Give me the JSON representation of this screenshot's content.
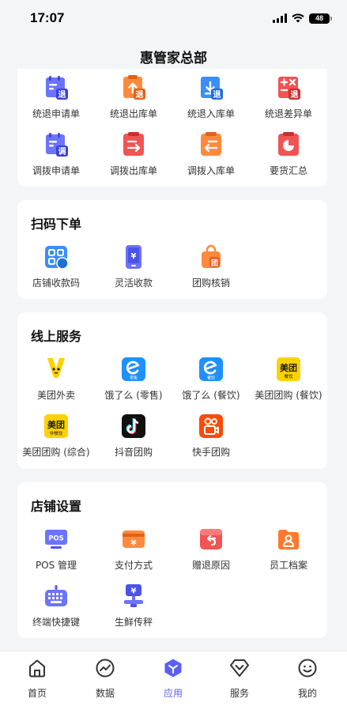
{
  "status": {
    "time": "17:07",
    "battery": "48"
  },
  "header": {
    "title": "惠管家总部"
  },
  "top_section": {
    "items": [
      {
        "label": "统退申请单",
        "icon": "return-request-icon"
      },
      {
        "label": "统退出库单",
        "icon": "return-outbound-icon"
      },
      {
        "label": "统退入库单",
        "icon": "return-inbound-icon"
      },
      {
        "label": "统退差异单",
        "icon": "return-diff-icon"
      },
      {
        "label": "调拨申请单",
        "icon": "transfer-request-icon"
      },
      {
        "label": "调拨出库单",
        "icon": "transfer-outbound-icon"
      },
      {
        "label": "调拨入库单",
        "icon": "transfer-inbound-icon"
      },
      {
        "label": "要货汇总",
        "icon": "order-summary-icon"
      }
    ],
    "badges": {
      "return": "退",
      "transfer": "调"
    }
  },
  "scan_section": {
    "title": "扫码下单",
    "items": [
      {
        "label": "店铺收款码",
        "icon": "qr-code-icon"
      },
      {
        "label": "灵活收款",
        "icon": "phone-payment-icon",
        "glyph": "¥"
      },
      {
        "label": "团购核销",
        "icon": "shopping-bag-icon",
        "glyph": "团"
      }
    ]
  },
  "online_section": {
    "title": "线上服务",
    "items": [
      {
        "label": "美团外卖",
        "icon": "meituan-waimai-icon"
      },
      {
        "label": "饿了么 (零售)",
        "icon": "eleme-retail-icon",
        "sub": "零售"
      },
      {
        "label": "饿了么 (餐饮)",
        "icon": "eleme-food-icon",
        "sub": "餐饮"
      },
      {
        "label": "美团团购 (餐饮)",
        "icon": "meituan-food-icon",
        "brand": "美团",
        "sub": "餐饮"
      },
      {
        "label": "美团团购 (综合)",
        "icon": "meituan-general-icon",
        "brand": "美团",
        "sub": "非餐饮"
      },
      {
        "label": "抖音团购",
        "icon": "douyin-icon"
      },
      {
        "label": "快手团购",
        "icon": "kuaishou-icon"
      }
    ]
  },
  "store_section": {
    "title": "店铺设置",
    "items": [
      {
        "label": "POS 管理",
        "icon": "pos-icon",
        "glyph": "POS"
      },
      {
        "label": "支付方式",
        "icon": "payment-card-icon",
        "glyph": "¥"
      },
      {
        "label": "赠退原因",
        "icon": "return-reason-icon"
      },
      {
        "label": "员工档案",
        "icon": "employee-folder-icon"
      },
      {
        "label": "终端快捷键",
        "icon": "keyboard-icon"
      },
      {
        "label": "生鲜传秤",
        "icon": "scale-icon",
        "glyph": "¥"
      }
    ]
  },
  "tabbar": {
    "items": [
      {
        "label": "首页",
        "icon": "home-icon"
      },
      {
        "label": "数据",
        "icon": "chart-icon"
      },
      {
        "label": "应用",
        "icon": "apps-icon",
        "active": true
      },
      {
        "label": "服务",
        "icon": "service-icon"
      },
      {
        "label": "我的",
        "icon": "profile-icon"
      }
    ]
  },
  "colors": {
    "accent": "#5b5ff5",
    "orange": "#ff7a2f",
    "red": "#f25353",
    "blue": "#3a8ef6",
    "background": "#f4f5f7"
  }
}
